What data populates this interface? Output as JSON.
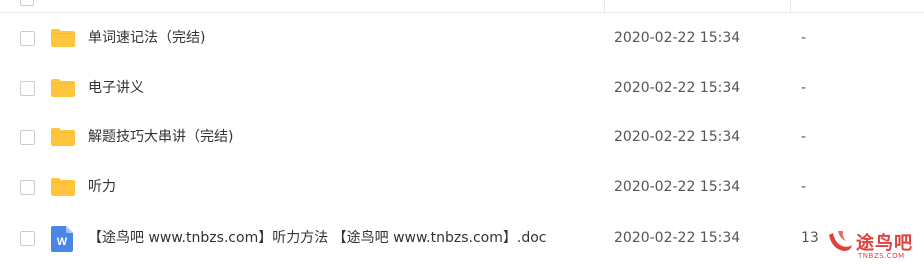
{
  "files": [
    {
      "name": "单词速记法（完结)",
      "type": "folder",
      "date": "2020-02-22 15:34",
      "size": "-"
    },
    {
      "name": "电子讲义",
      "type": "folder",
      "date": "2020-02-22 15:34",
      "size": "-"
    },
    {
      "name": "解题技巧大串讲（完结)",
      "type": "folder",
      "date": "2020-02-22 15:34",
      "size": "-"
    },
    {
      "name": "听力",
      "type": "folder",
      "date": "2020-02-22 15:34",
      "size": "-"
    },
    {
      "name": "【途鸟吧 www.tnbzs.com】听力方法 【途鸟吧 www.tnbzs.com】.doc",
      "type": "doc",
      "date": "2020-02-22 15:34",
      "size": "13"
    }
  ],
  "icons": {
    "folder": "folder-icon",
    "doc": "word-doc-icon",
    "doc_letter": "W"
  },
  "watermark": {
    "text": "途鸟吧",
    "sub": "TNBZS.COM"
  },
  "colors": {
    "folder": "#ffc53d",
    "folder_tab": "#f5b21f",
    "word": "#4a86e8",
    "watermark": "#e0433c"
  }
}
